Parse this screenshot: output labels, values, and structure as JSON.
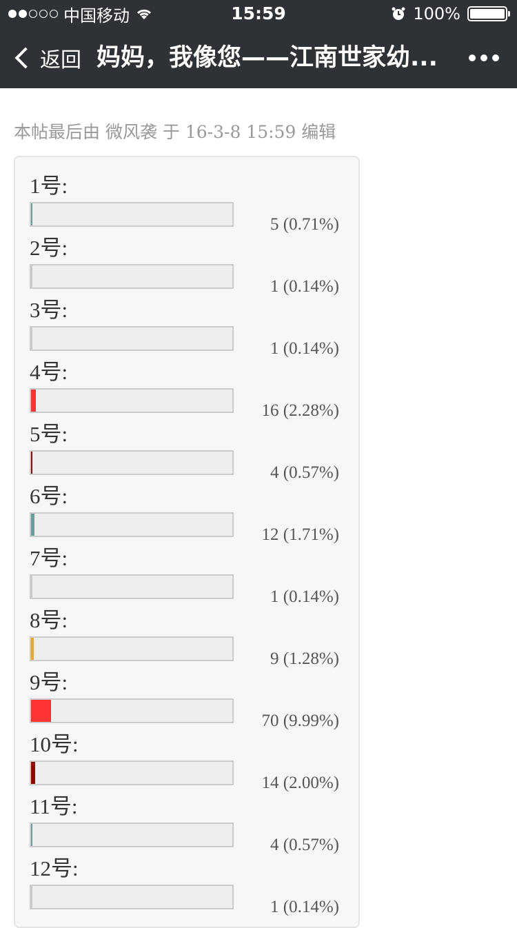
{
  "status_bar": {
    "carrier": "中国移动",
    "time": "15:59",
    "battery": "100%",
    "signal_strength": 2,
    "icons": [
      "signal-dots",
      "wifi-icon",
      "alarm-icon",
      "battery-icon"
    ]
  },
  "nav": {
    "back_label": "返回",
    "title": "妈妈，我像您——江南世家幼...",
    "more_icon": "more-dots-icon"
  },
  "edit_note": "本帖最后由 微风袭 于 16-3-8 15:59 编辑",
  "poll": {
    "options": [
      {
        "label": "1号:",
        "count": "5 (0.71%)",
        "percent": 0.71,
        "color": "#6a9c9c"
      },
      {
        "label": "2号:",
        "count": "1 (0.14%)",
        "percent": 0.14,
        "color": "#c8c8c8"
      },
      {
        "label": "3号:",
        "count": "1 (0.14%)",
        "percent": 0.14,
        "color": "#c8c8c8"
      },
      {
        "label": "4号:",
        "count": "16 (2.28%)",
        "percent": 2.28,
        "color": "#ff3333"
      },
      {
        "label": "5号:",
        "count": "4 (0.57%)",
        "percent": 0.57,
        "color": "#990000"
      },
      {
        "label": "6号:",
        "count": "12 (1.71%)",
        "percent": 1.71,
        "color": "#6a9c9c"
      },
      {
        "label": "7号:",
        "count": "1 (0.14%)",
        "percent": 0.14,
        "color": "#c8c8c8"
      },
      {
        "label": "8号:",
        "count": "9 (1.28%)",
        "percent": 1.28,
        "color": "#f5a623"
      },
      {
        "label": "9号:",
        "count": "70 (9.99%)",
        "percent": 9.99,
        "color": "#ff3333"
      },
      {
        "label": "10号:",
        "count": "14 (2.00%)",
        "percent": 2.0,
        "color": "#990000"
      },
      {
        "label": "11号:",
        "count": "4 (0.57%)",
        "percent": 0.57,
        "color": "#6a9c9c"
      },
      {
        "label": "12号:",
        "count": "1 (0.14%)",
        "percent": 0.14,
        "color": "#c8c8c8"
      }
    ]
  }
}
